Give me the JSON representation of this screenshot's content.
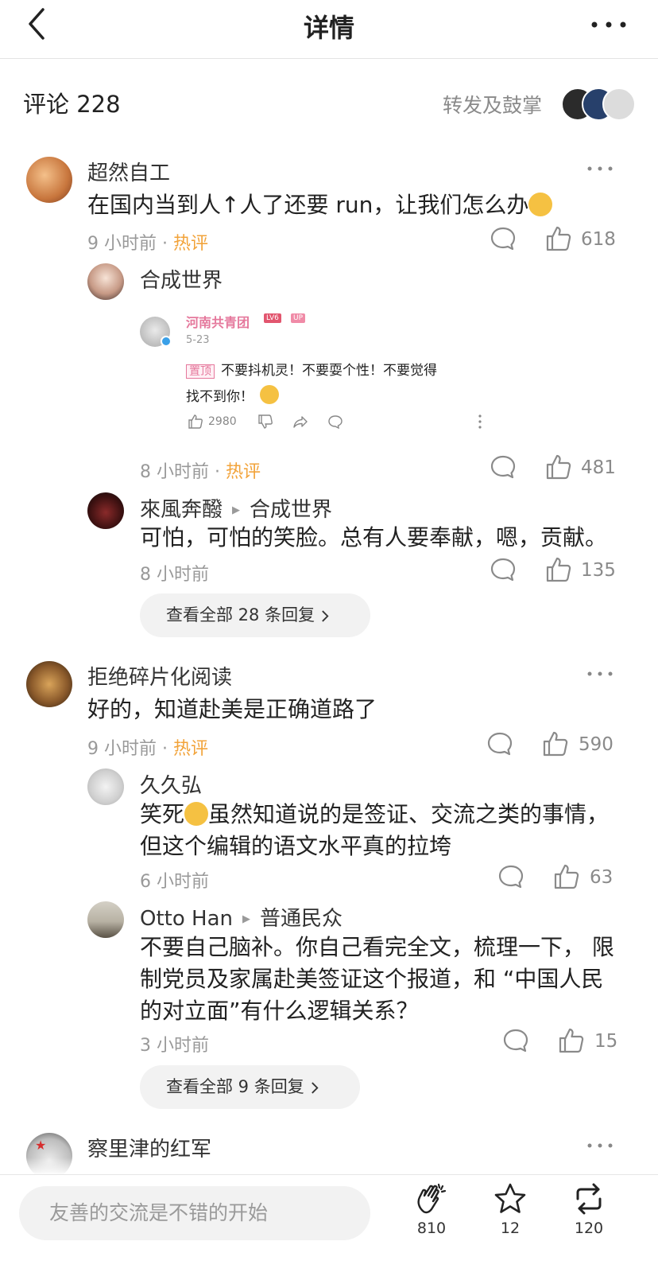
{
  "header": {
    "title": "详情"
  },
  "summary": {
    "comments_label": "评论 228",
    "repost_label": "转发及鼓掌"
  },
  "comments": [
    {
      "user": "超然自工",
      "text": "在国内当到人↑人了还要 run，让我们怎么办",
      "time": "9 小时前",
      "hot": "热评",
      "likes": "618",
      "replies": [
        {
          "user": "合成世界",
          "time": "8 小时前",
          "hot": "热评",
          "likes": "481"
        },
        {
          "user": "來風奔醱",
          "reply_to": "合成世界",
          "text": "可怕，可怕的笑脸。总有人要奉献，嗯，贡献。",
          "time": "8 小时前",
          "likes": "135"
        }
      ],
      "view_all": "查看全部 28 条回复"
    },
    {
      "user": "拒绝碎片化阅读",
      "text": "好的，知道赴美是正确道路了",
      "time": "9 小时前",
      "hot": "热评",
      "likes": "590",
      "replies": [
        {
          "user": "久久弘",
          "text_prefix": "笑死",
          "text_rest": "虽然知道说的是签证、交流之类的事情，",
          "text_line2": "但这个编辑的语文水平真的拉垮",
          "time": "6 小时前",
          "likes": "63"
        },
        {
          "user": "Otto Han",
          "reply_to": "普通民众",
          "text_line1": "不要自己脑补。你自己看完全文，梳理一下， 限",
          "text_line2": "制党员及家属赴美签证这个报道，和 “中国人民",
          "text_line3": "的对立面”有什么逻辑关系？",
          "time": "3 小时前",
          "likes": "15"
        }
      ],
      "view_all": "查看全部 9 条回复"
    },
    {
      "user": "察里津的红军"
    }
  ],
  "embed": {
    "name": "河南共青团",
    "badge_level": "LV6",
    "badge_up": "UP",
    "date": "5-23",
    "pin": "置顶",
    "text_line1": "不要抖机灵！不要耍个性！不要觉得",
    "text_line2": "找不到你！",
    "likes": "2980"
  },
  "bottom": {
    "input_placeholder": "友善的交流是不错的开始",
    "clap_count": "810",
    "star_count": "12",
    "repost_count": "120"
  },
  "colors": {
    "hot": "#f2a33a",
    "embed_pink": "#e5789c"
  }
}
